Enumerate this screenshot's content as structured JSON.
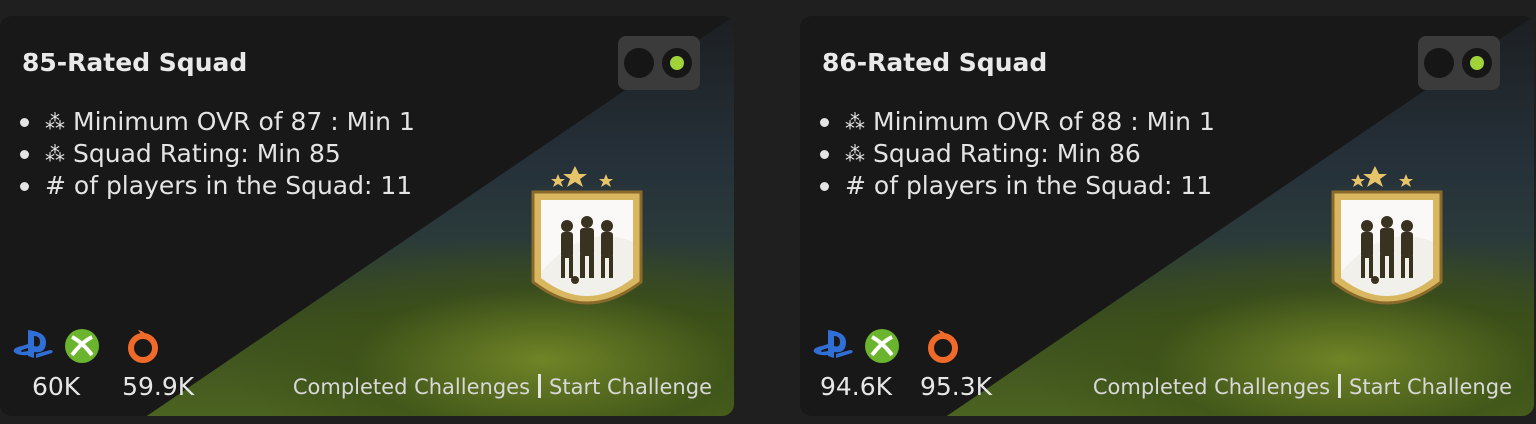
{
  "cards": [
    {
      "title": "85-Rated Squad",
      "requirements": [
        {
          "icon": "stars-icon",
          "text": "Minimum OVR of 87 : Min 1"
        },
        {
          "icon": "stars-icon",
          "text": "Squad Rating: Min 85"
        },
        {
          "icon": null,
          "text": "# of players in the Squad: 11"
        }
      ],
      "prices": {
        "console": "60K",
        "pc": "59.9K"
      },
      "links": {
        "completed": "Completed Challenges",
        "start": "Start Challenge"
      }
    },
    {
      "title": "86-Rated Squad",
      "requirements": [
        {
          "icon": "stars-icon",
          "text": "Minimum OVR of 88 : Min 1"
        },
        {
          "icon": "stars-icon",
          "text": "Squad Rating: Min 86"
        },
        {
          "icon": null,
          "text": "# of players in the Squad: 11"
        }
      ],
      "prices": {
        "console": "94.6K",
        "pc": "95.3K"
      },
      "links": {
        "completed": "Completed Challenges",
        "start": "Start Challenge"
      }
    }
  ],
  "colors": {
    "accent_green": "#9fd338",
    "playstation": "#2f6fd6",
    "xbox": "#6bb52e",
    "origin": "#f06a2a"
  },
  "icons": [
    "playstation-icon",
    "xbox-icon",
    "origin-icon",
    "stars-icon",
    "squad-badge-icon"
  ]
}
